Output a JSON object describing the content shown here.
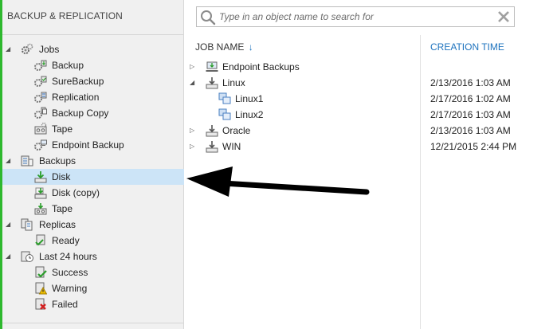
{
  "left_panel": {
    "title": "BACKUP & REPLICATION",
    "tree": [
      {
        "label": "Jobs",
        "level": 0,
        "expanded": true,
        "icon": "gears-icon"
      },
      {
        "label": "Backup",
        "level": 1,
        "icon": "backup-job-icon"
      },
      {
        "label": "SureBackup",
        "level": 1,
        "icon": "surebackup-job-icon"
      },
      {
        "label": "Replication",
        "level": 1,
        "icon": "replication-job-icon"
      },
      {
        "label": "Backup Copy",
        "level": 1,
        "icon": "backup-copy-job-icon"
      },
      {
        "label": "Tape",
        "level": 1,
        "icon": "tape-job-icon"
      },
      {
        "label": "Endpoint Backup",
        "level": 1,
        "icon": "endpoint-backup-job-icon"
      },
      {
        "label": "Backups",
        "level": 0,
        "expanded": true,
        "icon": "backups-icon"
      },
      {
        "label": "Disk",
        "level": 1,
        "selected": true,
        "icon": "disk-icon"
      },
      {
        "label": "Disk (copy)",
        "level": 1,
        "icon": "disk-copy-icon"
      },
      {
        "label": "Tape",
        "level": 1,
        "icon": "tape-icon"
      },
      {
        "label": "Replicas",
        "level": 0,
        "expanded": true,
        "icon": "replicas-icon"
      },
      {
        "label": "Ready",
        "level": 1,
        "icon": "ready-icon"
      },
      {
        "label": "Last 24 hours",
        "level": 0,
        "expanded": true,
        "icon": "clock-icon"
      },
      {
        "label": "Success",
        "level": 1,
        "icon": "success-icon"
      },
      {
        "label": "Warning",
        "level": 1,
        "icon": "warning-icon"
      },
      {
        "label": "Failed",
        "level": 1,
        "icon": "failed-icon"
      }
    ]
  },
  "search": {
    "placeholder": "Type in an object name to search for",
    "value": ""
  },
  "table": {
    "columns": {
      "job_name": "JOB NAME",
      "creation_time": "CREATION TIME"
    },
    "sort_indicator": "↓",
    "rows": [
      {
        "name": "Endpoint Backups",
        "time": "",
        "level": 0,
        "expandable": true,
        "expanded": false,
        "icon": "endpoint-backups-icon"
      },
      {
        "name": "Linux",
        "time": "2/13/2016 1:03 AM",
        "level": 0,
        "expandable": true,
        "expanded": true,
        "icon": "server-backup-icon"
      },
      {
        "name": "Linux1",
        "time": "2/17/2016 1:02 AM",
        "level": 1,
        "expandable": false,
        "icon": "vm-icon"
      },
      {
        "name": "Linux2",
        "time": "2/17/2016 1:03 AM",
        "level": 1,
        "expandable": false,
        "icon": "vm-icon"
      },
      {
        "name": "Oracle",
        "time": "2/13/2016 1:03 AM",
        "level": 0,
        "expandable": true,
        "expanded": false,
        "icon": "server-backup-icon"
      },
      {
        "name": "WIN",
        "time": "12/21/2015 2:44 PM",
        "level": 0,
        "expandable": true,
        "expanded": false,
        "icon": "server-backup-icon"
      }
    ]
  },
  "colors": {
    "accent_green": "#2eb82e",
    "link_blue": "#1e73be",
    "selection": "#cce4f7"
  }
}
